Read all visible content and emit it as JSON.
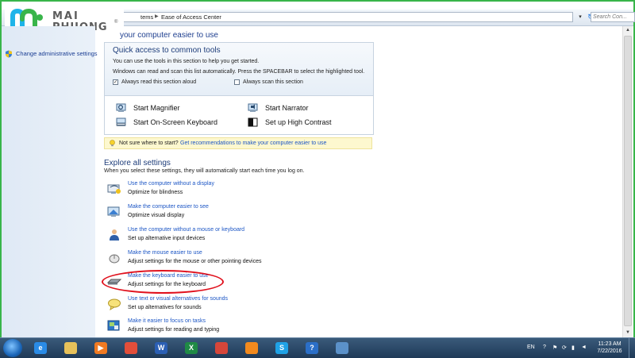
{
  "logo": {
    "line1": "MAI",
    "line2": "PHUONG",
    "mark": "®"
  },
  "address_bar": {
    "crumbs": [
      "tems",
      "Ease of Access Center"
    ],
    "search_placeholder": "Search Con..."
  },
  "left_nav": {
    "items": [
      {
        "label": "Change administrative settings",
        "icon": "shield-icon"
      }
    ]
  },
  "main": {
    "page_title": "your computer easier to use",
    "quick_access": {
      "title": "Quick access to common tools",
      "line1": "You can use the tools in this section to help you get started.",
      "line2": "Windows can read and scan this list automatically.  Press the SPACEBAR to select the highlighted tool.",
      "always_read": {
        "label": "Always read this section aloud",
        "checked": true,
        "mark": "✓"
      },
      "always_scan": {
        "label": "Always scan this section",
        "checked": false,
        "mark": ""
      },
      "tools": [
        {
          "label": "Start Magnifier",
          "icon": "magnifier-icon"
        },
        {
          "label": "Start Narrator",
          "icon": "narrator-icon"
        },
        {
          "label": "Start On-Screen Keyboard",
          "icon": "keyboard-icon"
        },
        {
          "label": "Set up High Contrast",
          "icon": "contrast-icon"
        }
      ]
    },
    "tip": {
      "text": "Not sure where to start?",
      "link": "Get recommendations to make your computer easier to use"
    },
    "explore": {
      "title": "Explore all settings",
      "desc": "When you select these settings, they will automatically start each time you log on.",
      "items": [
        {
          "link": "Use the computer without a display",
          "desc": "Optimize for blindness",
          "icon": "display-icon"
        },
        {
          "link": "Make the computer easier to see",
          "desc": "Optimize visual display",
          "icon": "monitor-magnify-icon"
        },
        {
          "link": "Use the computer without a mouse or keyboard",
          "desc": "Set up alternative input devices",
          "icon": "person-icon"
        },
        {
          "link": "Make the mouse easier to use",
          "desc": "Adjust settings for the mouse or other pointing devices",
          "icon": "mouse-icon"
        },
        {
          "link": "Make the keyboard easier to use",
          "desc": "Adjust settings for the keyboard",
          "icon": "keyboard-icon"
        },
        {
          "link": "Use text or visual alternatives for sounds",
          "desc": "Set up alternatives for sounds",
          "icon": "speech-bubble-icon"
        },
        {
          "link": "Make it easier to focus on tasks",
          "desc": "Adjust settings for reading and typing",
          "icon": "focus-icon"
        }
      ]
    }
  },
  "taskbar": {
    "apps": [
      {
        "name": "internet-explorer",
        "glyph": "e",
        "color": "#2a8be6"
      },
      {
        "name": "file-explorer",
        "glyph": "",
        "color": "#e7c15a"
      },
      {
        "name": "media-player",
        "glyph": "▶",
        "color": "#f07a22"
      },
      {
        "name": "chrome",
        "glyph": "",
        "color": "#e24e3a"
      },
      {
        "name": "word",
        "glyph": "W",
        "color": "#2b5fb4"
      },
      {
        "name": "excel",
        "glyph": "X",
        "color": "#1f8a45"
      },
      {
        "name": "paint",
        "glyph": "",
        "color": "#d6463a"
      },
      {
        "name": "firefox",
        "glyph": "",
        "color": "#f28a1e"
      },
      {
        "name": "skype",
        "glyph": "S",
        "color": "#1fa2e6"
      },
      {
        "name": "help",
        "glyph": "?",
        "color": "#2b6fc8"
      },
      {
        "name": "control-panel",
        "glyph": "",
        "color": "#5b91c9"
      }
    ],
    "language": "EN",
    "time": "11:23 AM",
    "date": "7/22/2016"
  },
  "colors": {
    "link": "#1c56c5",
    "frame": "#39b54a",
    "annotation": "#e0101c"
  }
}
